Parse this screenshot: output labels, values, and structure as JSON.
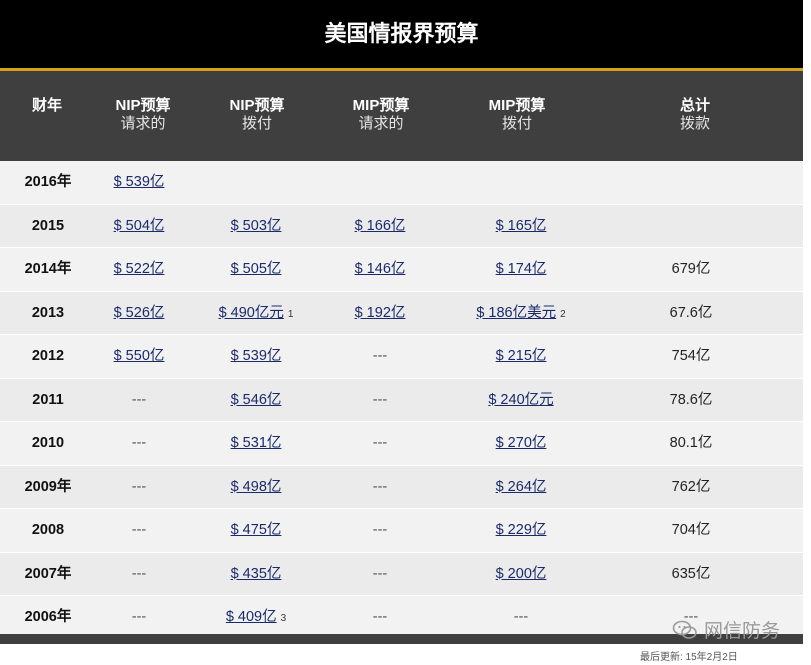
{
  "title": "美国情报界预算",
  "headers": [
    {
      "main": "财年",
      "sub": ""
    },
    {
      "main": "NIP预算",
      "sub": "请求的"
    },
    {
      "main": "NIP预算",
      "sub": "拨付"
    },
    {
      "main": "MIP预算",
      "sub": "请求的"
    },
    {
      "main": "MIP预算",
      "sub": "拨付"
    },
    {
      "main": "总计",
      "sub": "拨款"
    }
  ],
  "rows": [
    {
      "year": "2016年",
      "nip_req": "$ 539亿",
      "nip_app": "",
      "nip_app_note": "",
      "mip_req": "",
      "mip_app": "",
      "mip_app_note": "",
      "total": ""
    },
    {
      "year": "2015",
      "nip_req": "$ 504亿",
      "nip_app": "$ 503亿",
      "nip_app_note": "",
      "mip_req": "$ 166亿",
      "mip_app": "$ 165亿",
      "mip_app_note": "",
      "total": ""
    },
    {
      "year": "2014年",
      "nip_req": "$ 522亿",
      "nip_app": "$ 505亿",
      "nip_app_note": "",
      "mip_req": "$ 146亿",
      "mip_app": "$ 174亿",
      "mip_app_note": "",
      "total": "679亿"
    },
    {
      "year": "2013",
      "nip_req": "$ 526亿",
      "nip_app": "$ 490亿元",
      "nip_app_note": "1",
      "mip_req": "$ 192亿",
      "mip_app": "$ 186亿美元",
      "mip_app_note": "2",
      "total": "67.6亿"
    },
    {
      "year": "2012",
      "nip_req": "$ 550亿",
      "nip_app": "$ 539亿",
      "nip_app_note": "",
      "mip_req": "---",
      "mip_app": "$ 215亿",
      "mip_app_note": "",
      "total": "754亿"
    },
    {
      "year": "2011",
      "nip_req": "---",
      "nip_app": "$ 546亿",
      "nip_app_note": "",
      "mip_req": "---",
      "mip_app": "$ 240亿元",
      "mip_app_note": "",
      "total": "78.6亿"
    },
    {
      "year": "2010",
      "nip_req": "---",
      "nip_app": "$ 531亿",
      "nip_app_note": "",
      "mip_req": "---",
      "mip_app": "$ 270亿",
      "mip_app_note": "",
      "total": "80.1亿"
    },
    {
      "year": "2009年",
      "nip_req": "---",
      "nip_app": "$ 498亿",
      "nip_app_note": "",
      "mip_req": "---",
      "mip_app": "$ 264亿",
      "mip_app_note": "",
      "total": "762亿"
    },
    {
      "year": "2008",
      "nip_req": "---",
      "nip_app": "$ 475亿",
      "nip_app_note": "",
      "mip_req": "---",
      "mip_app": "$ 229亿",
      "mip_app_note": "",
      "total": "704亿"
    },
    {
      "year": "2007年",
      "nip_req": "---",
      "nip_app": "$ 435亿",
      "nip_app_note": "",
      "mip_req": "---",
      "mip_app": "$ 200亿",
      "mip_app_note": "",
      "total": "635亿"
    },
    {
      "year": "2006年",
      "nip_req": "---",
      "nip_app": "$ 409亿",
      "nip_app_note": "3",
      "mip_req": "---",
      "mip_app": "---",
      "mip_app_note": "",
      "total": "---"
    }
  ],
  "footer": {
    "updated": "最后更新: 15年2月2日"
  },
  "watermark": {
    "text": "网信防务",
    "icon": "wechat-logo-icon"
  },
  "colors": {
    "title_bg": "#000000",
    "accent": "#d8a21a",
    "header_bg": "#3f3f3f",
    "link": "#1a2a6b"
  }
}
